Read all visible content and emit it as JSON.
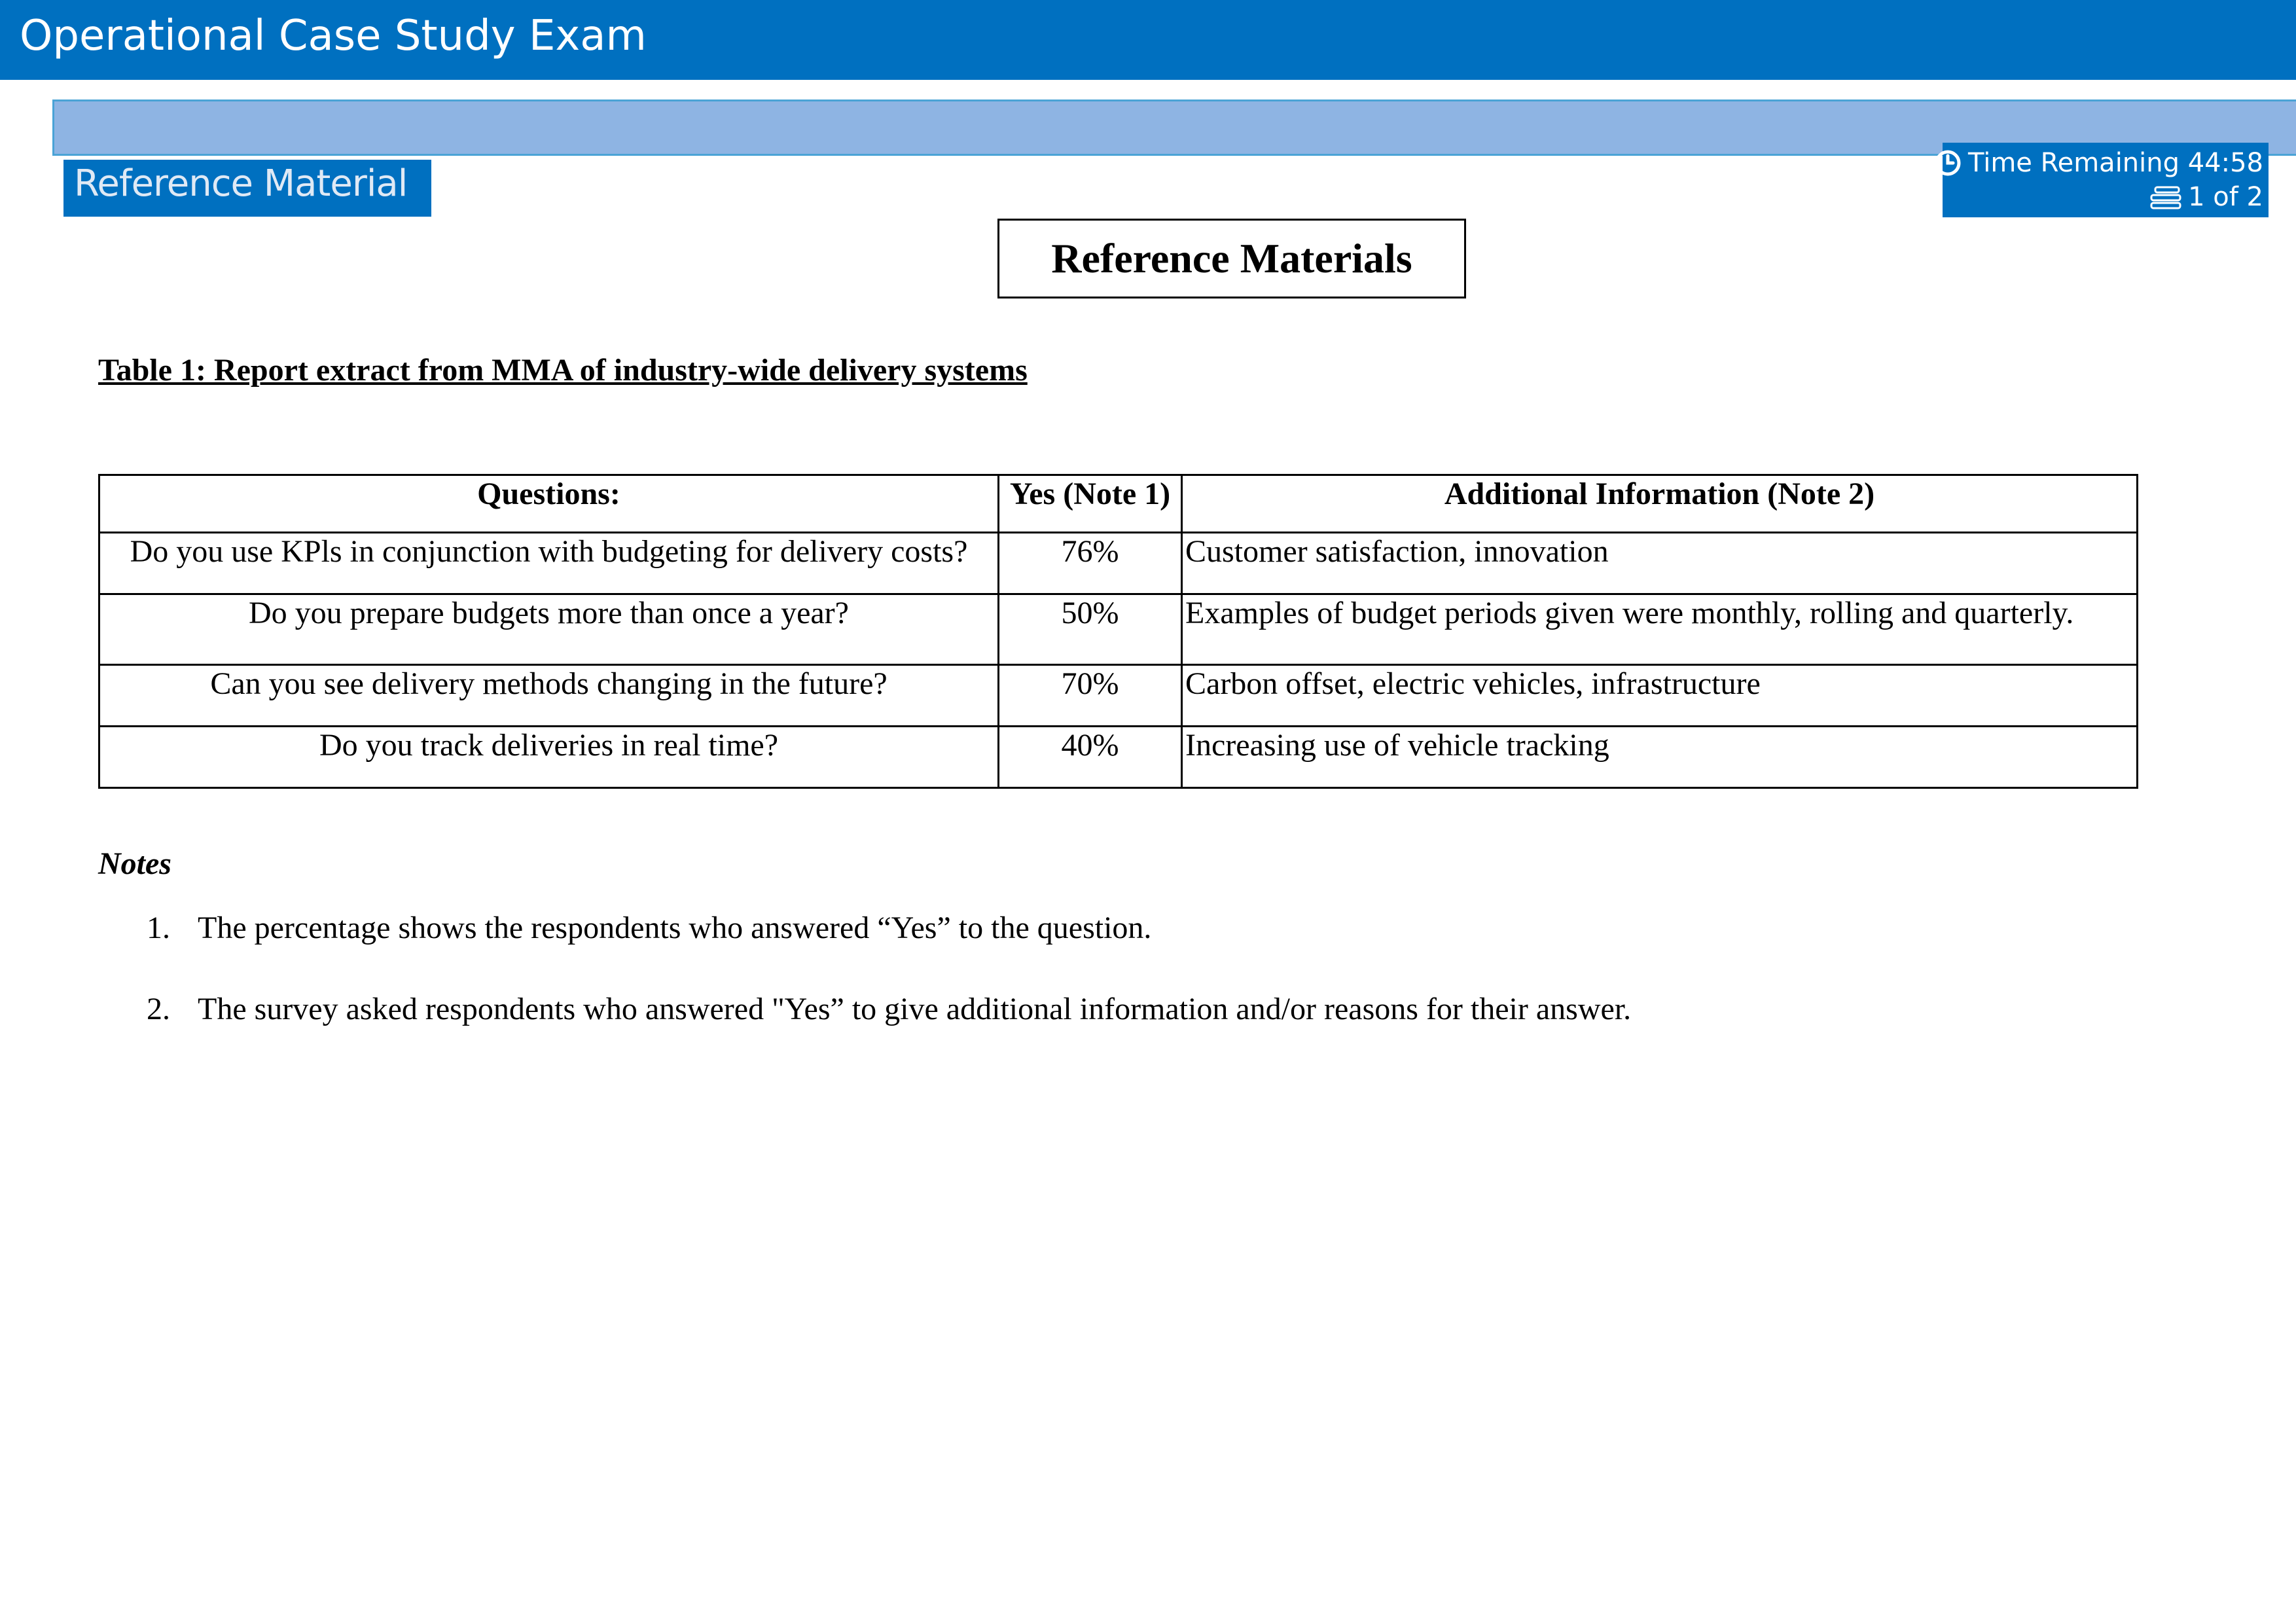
{
  "app": {
    "title": "Operational Case Study Exam"
  },
  "tab": {
    "label": "Reference Material"
  },
  "timer": {
    "label": "Time Remaining 44:58",
    "page": "1 of 2",
    "clock_icon": "clock-icon",
    "pages_icon": "pages-icon"
  },
  "colors": {
    "header": "#0070c0",
    "lightbar": "#8eb4e3",
    "text": "#000000"
  },
  "document": {
    "heading": "Reference Materials",
    "table_caption": "Table 1: Report extract from MMA of  industry-wide delivery systems",
    "table": {
      "headers": [
        "Questions:",
        "Yes (Note 1)",
        "Additional Information (Note 2)"
      ],
      "rows": [
        [
          "Do you use KPls in conjunction with budgeting for delivery costs?",
          "76%",
          "Customer satisfaction, innovation"
        ],
        [
          "Do you prepare budgets more than once a year?",
          "50%",
          "Examples of budget periods given were monthly, rolling and quarterly."
        ],
        [
          "Can you see delivery methods changing in the future?",
          "70%",
          "Carbon offset, electric vehicles, infrastructure"
        ],
        [
          "Do you track deliveries in real time?",
          "40%",
          "Increasing use of vehicle tracking"
        ]
      ]
    },
    "notes_title": "Notes",
    "notes": [
      {
        "num": "1.",
        "text": "The percentage shows the respondents who answered “Yes” to the question."
      },
      {
        "num": "2.",
        "text": "The survey asked respondents who answered \"Yes” to give additional information and/or reasons for their answer."
      }
    ]
  }
}
